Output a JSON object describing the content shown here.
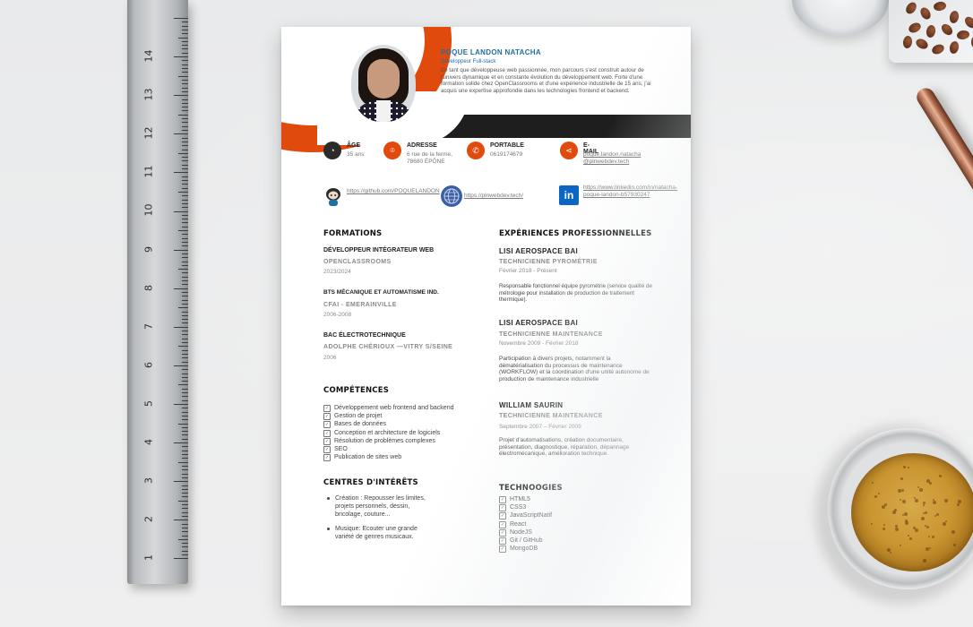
{
  "scene": {
    "ruler_numbers": [
      "14",
      "13",
      "12",
      "11",
      "10",
      "9",
      "8",
      "7",
      "6",
      "5",
      "4",
      "3",
      "2",
      "1"
    ],
    "colors": {
      "accent": "#e04a0c",
      "band": "#1e1e1e",
      "name": "#1f6fa0",
      "background": "#ecedee"
    }
  },
  "cv": {
    "name": "POQUE LANDON NATACHA",
    "role": "Développeur Full-stack",
    "intro": "En tant que développeuse web passionnée, mon parcours s'est construit autour de l'univers dynamique et en constante évolution du développement web. Forte d'une formation solide chez OpenClassrooms et d'une expérience industrielle de 15 ans, j'ai acquis une expertise approfondie dans les technologies frontend et backend.",
    "info": {
      "age_label": "ÂGE",
      "age_value": "35  ans",
      "address_label": "ADRESSE",
      "address_value": "6 rue de la ferme, 78680 ÉPÔNE",
      "phone_label": "PORTABLE",
      "phone_value": "0619174679",
      "email_label": "E-MAIL",
      "email_value": "poque.landon.natacha @plnwebdev.tech"
    },
    "links": {
      "github": "https://github.com/POQUELANDON",
      "website": "https://plnwebdev.tech/",
      "linkedin": "https://www.linkedin.com/in/natacha-poque-landon-b57930247"
    },
    "formations": {
      "title": "FORMATIONS",
      "items": [
        {
          "degree": "DÉVELOPPEUR INTÉGRATEUR WEB",
          "school": "OPENCLASSROOMS",
          "date": "2023/2024"
        },
        {
          "degree": "BTS MÉCANIQUE ET AUTOMATISME IND.",
          "school": "CFAI - EMERAINVILLE",
          "date": "2006-2008"
        },
        {
          "degree": "BAC ÉLECTROTECHNIQUE",
          "school": "ADOLPHE CHÉRIOUX —VITRY S/SEINE",
          "date": "2006"
        }
      ]
    },
    "competences": {
      "title": "COMPÉTENCES",
      "items": [
        "Développement web frontend and backend",
        "Gestion de projet",
        "Bases de données",
        "Conception et architecture de logiciels",
        "Résolution de problèmes complexes",
        "SEO",
        "Publication de sites web"
      ]
    },
    "interets": {
      "title": "CENTRES D'INTÉRÊTS",
      "items": [
        "Création : Repousser les limites, projets personnels, dessin,  bricolage, couture...",
        "Musique: Ecouter une grande variété de genres musicaux."
      ]
    },
    "experiences": {
      "title": "EXPÉRIENCES PROFESSIONNELLES",
      "items": [
        {
          "company": "LISI AEROSPACE BAI",
          "position": "TECHNICIENNE PYROMÉTRIE",
          "date": "Février 2018 - Présent",
          "desc": "Responsable fonctionnel équipe pyrométrie (service qualité de métrologie pour installation de production de traitement thermique)."
        },
        {
          "company": "LISI AEROSPACE BAI",
          "position": "TECHNICIENNE MAINTENANCE",
          "date": "Novembre 2009 - Février 2018",
          "desc": "Participation à divers projets, notamment la dématérialisation du processus de maintenance (WORKFLOW) et la coordination d'une unité autonome de production de maintenance industrielle"
        },
        {
          "company": "WILLIAM SAURIN",
          "position": "TECHNICIENNE MAINTENANCE",
          "date": "Septembre 2007 – Février 2009",
          "desc": "Projet d'automatisations, création documentaire, présentation, diagnostique, réparation, dépannage électromécanique, amélioration technique."
        }
      ]
    },
    "technologies": {
      "title": "TECHNOOGIES",
      "items": [
        "HTML5",
        "CSS3",
        "JavaScriptNatif",
        "React",
        "NodeJS",
        "Git / GitHub",
        "MongoDB"
      ]
    }
  }
}
